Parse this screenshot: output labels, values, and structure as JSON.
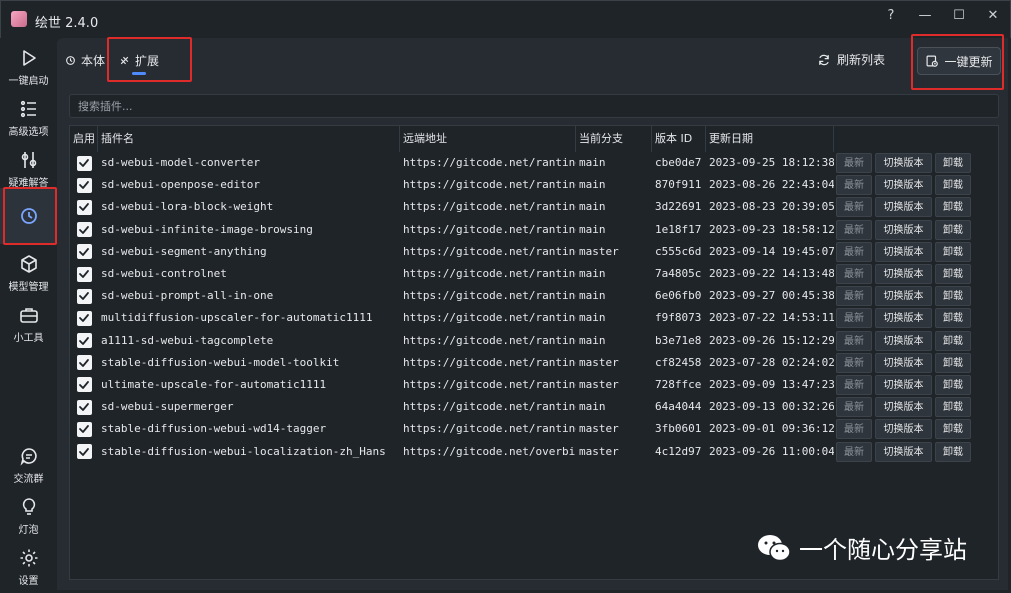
{
  "app": {
    "title": "绘世 2.4.0"
  },
  "window_controls": {
    "help": "?",
    "minimize": "—",
    "maximize": "☐",
    "close": "✕"
  },
  "sidebar": {
    "items": [
      {
        "label": "一键启动",
        "icon": "play-icon"
      },
      {
        "label": "高级选项",
        "icon": "list-icon"
      },
      {
        "label": "疑难解答",
        "icon": "tools-icon"
      },
      {
        "label": "",
        "icon": "history-icon",
        "active": true
      },
      {
        "label": "模型管理",
        "icon": "cube-icon"
      },
      {
        "label": "小工具",
        "icon": "toolbox-icon"
      },
      {
        "label": "交流群",
        "icon": "chat-icon"
      },
      {
        "label": "灯泡",
        "icon": "bulb-icon"
      },
      {
        "label": "设置",
        "icon": "gear-icon"
      }
    ]
  },
  "tabs": [
    {
      "label": "本体",
      "icon": "history-icon"
    },
    {
      "label": "扩展",
      "icon": "plugin-icon",
      "active": true
    }
  ],
  "toolbar": {
    "refresh_label": "刷新列表",
    "update_all_label": "一键更新"
  },
  "search": {
    "placeholder": "搜索插件..."
  },
  "table": {
    "headers": {
      "enabled": "启用",
      "name": "插件名",
      "url": "远端地址",
      "branch": "当前分支",
      "version": "版本 ID",
      "date": "更新日期"
    },
    "op_labels": {
      "latest": "最新",
      "switch": "切换版本",
      "uninstall": "卸载"
    },
    "rows": [
      {
        "name": "sd-webui-model-converter",
        "url": "https://gitcode.net/ranting",
        "branch": "main",
        "version": "cbe0de7",
        "date": "2023-09-25 18:12:38"
      },
      {
        "name": "sd-webui-openpose-editor",
        "url": "https://gitcode.net/ranting",
        "branch": "main",
        "version": "870f911",
        "date": "2023-08-26 22:43:04"
      },
      {
        "name": "sd-webui-lora-block-weight",
        "url": "https://gitcode.net/ranting",
        "branch": "main",
        "version": "3d22691",
        "date": "2023-08-23 20:39:05"
      },
      {
        "name": "sd-webui-infinite-image-browsing",
        "url": "https://gitcode.net/ranting",
        "branch": "main",
        "version": "1e18f17",
        "date": "2023-09-23 18:58:12"
      },
      {
        "name": "sd-webui-segment-anything",
        "url": "https://gitcode.net/ranting",
        "branch": "master",
        "version": "c555c6d",
        "date": "2023-09-14 19:45:07"
      },
      {
        "name": "sd-webui-controlnet",
        "url": "https://gitcode.net/ranting",
        "branch": "main",
        "version": "7a4805c",
        "date": "2023-09-22 14:13:48"
      },
      {
        "name": "sd-webui-prompt-all-in-one",
        "url": "https://gitcode.net/ranting",
        "branch": "main",
        "version": "6e06fb0",
        "date": "2023-09-27 00:45:38"
      },
      {
        "name": "multidiffusion-upscaler-for-automatic1111",
        "url": "https://gitcode.net/ranting",
        "branch": "main",
        "version": "f9f8073",
        "date": "2023-07-22 14:53:11"
      },
      {
        "name": "a1111-sd-webui-tagcomplete",
        "url": "https://gitcode.net/ranting",
        "branch": "main",
        "version": "b3e71e8",
        "date": "2023-09-26 15:12:29"
      },
      {
        "name": "stable-diffusion-webui-model-toolkit",
        "url": "https://gitcode.net/ranting",
        "branch": "master",
        "version": "cf82458",
        "date": "2023-07-28 02:24:02"
      },
      {
        "name": "ultimate-upscale-for-automatic1111",
        "url": "https://gitcode.net/ranting",
        "branch": "master",
        "version": "728ffce",
        "date": "2023-09-09 13:47:23"
      },
      {
        "name": "sd-webui-supermerger",
        "url": "https://gitcode.net/ranting",
        "branch": "main",
        "version": "64a4044",
        "date": "2023-09-13 00:32:26"
      },
      {
        "name": "stable-diffusion-webui-wd14-tagger",
        "url": "https://gitcode.net/ranting",
        "branch": "master",
        "version": "3fb0601",
        "date": "2023-09-01 09:36:12"
      },
      {
        "name": "stable-diffusion-webui-localization-zh_Hans",
        "url": "https://gitcode.net/overbil",
        "branch": "master",
        "version": "4c12d97",
        "date": "2023-09-26 11:00:04"
      }
    ]
  },
  "watermark": {
    "text": "一个随心分享站"
  },
  "colors": {
    "accent": "#4f8bff",
    "highlight": "#e02b2b",
    "panel": "#272c33",
    "background": "#1f2429"
  }
}
